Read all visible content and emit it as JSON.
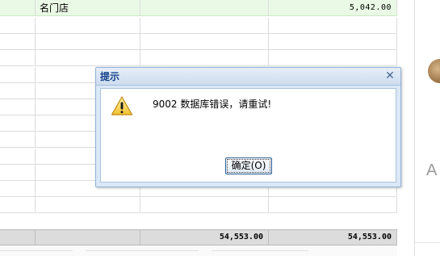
{
  "table": {
    "highlight_row": {
      "store_name": "名门店",
      "amount": "5,042.00"
    },
    "empty_rows": 12,
    "totals": {
      "col3": "54,553.00",
      "col4": "54,553.00"
    }
  },
  "dialog": {
    "title": "提示",
    "message": "9002 数据库错误，请重试!",
    "ok_label": "确定(O)",
    "close_icon": "close-icon",
    "icon": "warning-icon"
  },
  "side_panel": {
    "letter": "A"
  },
  "colors": {
    "highlight_row": "#eaf9e6",
    "dialog_title_text": "#15428b",
    "dialog_border": "#8fb2d6"
  }
}
